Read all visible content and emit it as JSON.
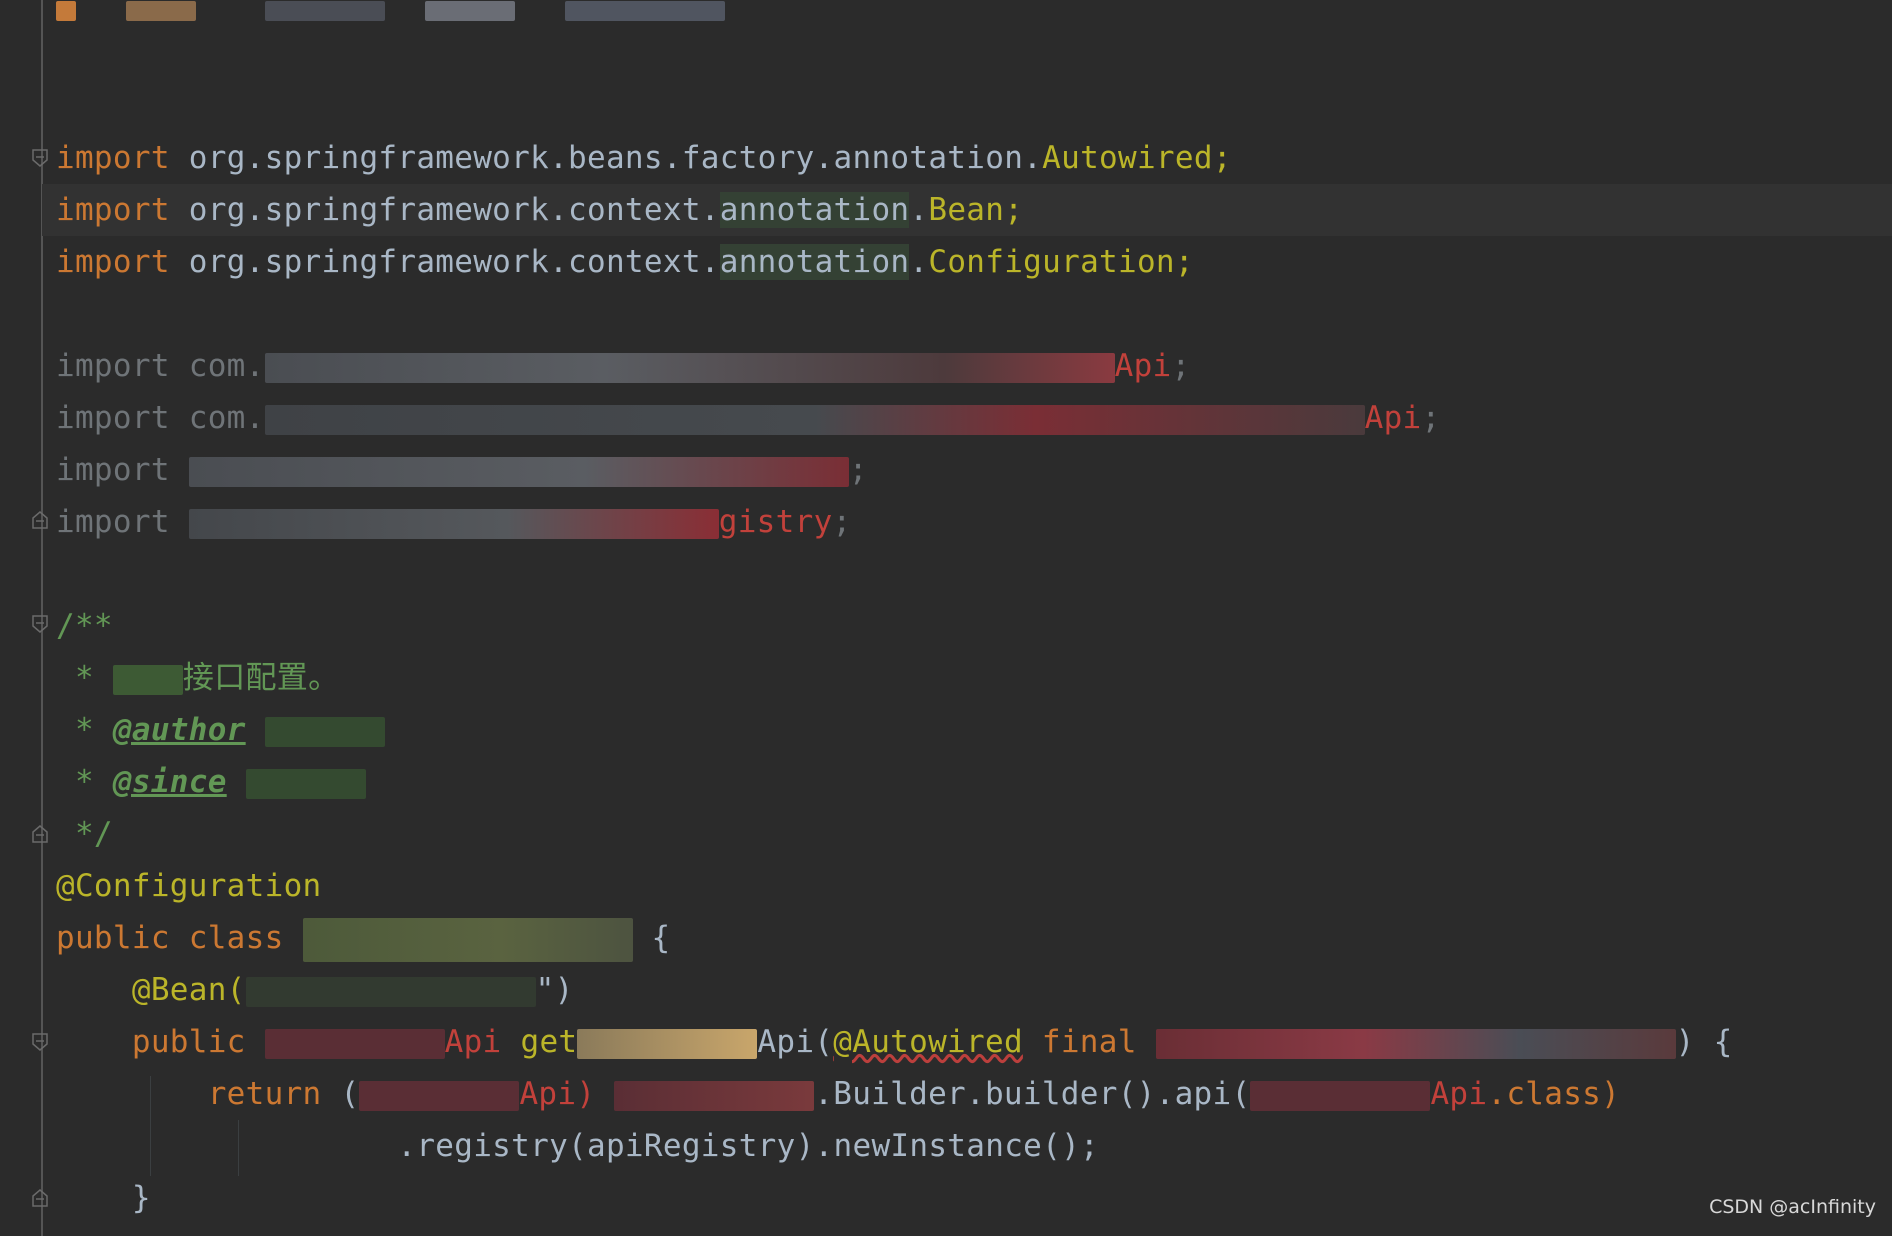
{
  "editor": {
    "lines": {
      "l1_kw": "import",
      "l1_pkg": "org.springframework.beans.factory.annotation.",
      "l1_cls": "Autowired;",
      "l2_kw": "import",
      "l2_pkg_a": "org.springframework.context.",
      "l2_pkg_hl": "annotation",
      "l2_pkg_b": ".",
      "l2_cls": "Bean;",
      "l3_kw": "import",
      "l3_pkg_a": "org.springframework.context.",
      "l3_pkg_hl": "annotation",
      "l3_pkg_b": ".",
      "l3_cls": "Configuration;",
      "l5_a": "import com.",
      "l5_b": "Api",
      "l5_c": ";",
      "l6_a": "import com.",
      "l6_b": "Api",
      "l6_c": ";",
      "l7_a": "import ",
      "l7_c": ";",
      "l8_a": "import ",
      "l8_b": "gistry",
      "l8_c": ";",
      "doc_open": "/**",
      "doc_star1": " * ",
      "doc_cn": "接口配置。",
      "doc_star2": " * ",
      "doc_author": "@author",
      "doc_star3": " * ",
      "doc_since": "@since",
      "doc_close": " */",
      "annotation_config": "@Configuration",
      "class_kw": "public class",
      "class_brace": "{",
      "bean_ann": "@Bean(",
      "bean_close": "\")",
      "method_kw": "public",
      "method_type": "Api",
      "method_get": "get",
      "method_api": "Api(",
      "method_autowired": "@Autowired",
      "method_final": "final",
      "method_close": ") {",
      "return_kw": "return",
      "return_a": "(",
      "return_api": "Api)",
      "return_builder": ".Builder.builder().api(",
      "return_apiclass": "Api",
      "return_class": ".class)",
      "registry_line": ".registry(apiRegistry).newInstance();",
      "closing_brace": "}"
    }
  },
  "watermark": "CSDN @acInfinity",
  "colors": {
    "background": "#2b2b2b",
    "keyword": "#cc7832",
    "class_name": "#bbb529",
    "text": "#a9b7c6",
    "javadoc": "#629755",
    "error_red": "#c2413b"
  }
}
